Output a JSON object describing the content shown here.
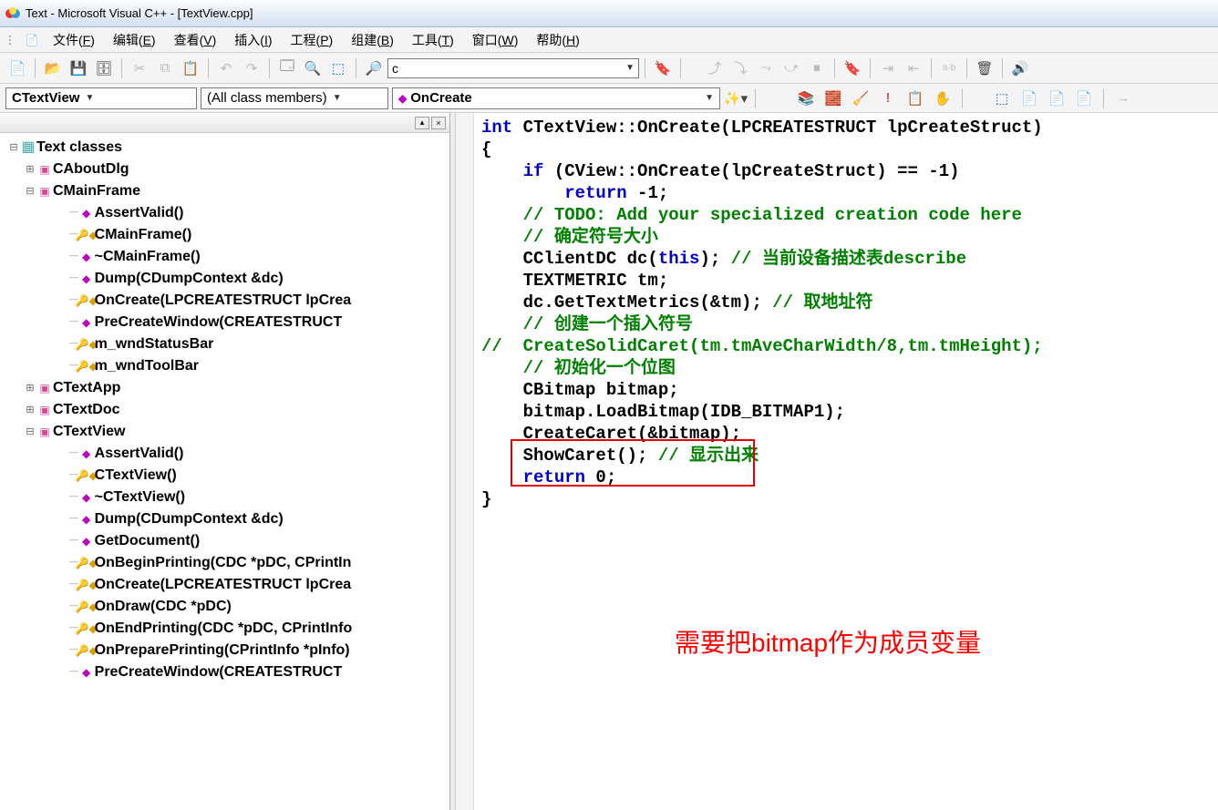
{
  "titlebar": {
    "title": "Text - Microsoft Visual C++ - [TextView.cpp]"
  },
  "menu": {
    "items": [
      {
        "label": "文件(F)",
        "key": "F"
      },
      {
        "label": "编辑(E)",
        "key": "E"
      },
      {
        "label": "查看(V)",
        "key": "V"
      },
      {
        "label": "插入(I)",
        "key": "I"
      },
      {
        "label": "工程(P)",
        "key": "P"
      },
      {
        "label": "组建(B)",
        "key": "B"
      },
      {
        "label": "工具(T)",
        "key": "T"
      },
      {
        "label": "窗口(W)",
        "key": "W"
      },
      {
        "label": "帮助(H)",
        "key": "H"
      }
    ]
  },
  "toolbar": {
    "search_value": "c"
  },
  "wizardbar": {
    "class_combo": "CTextView",
    "filter_combo": "(All class members)",
    "member_combo": "OnCreate"
  },
  "classview": {
    "root": "Text classes",
    "nodes": [
      {
        "type": "class",
        "label": "CAboutDlg",
        "expand": "plus"
      },
      {
        "type": "class",
        "label": "CMainFrame",
        "expand": "minus",
        "children": [
          {
            "icon": "pub",
            "label": "AssertValid()"
          },
          {
            "icon": "prot",
            "label": "CMainFrame()"
          },
          {
            "icon": "pub",
            "label": "~CMainFrame()"
          },
          {
            "icon": "pub",
            "label": "Dump(CDumpContext &dc)"
          },
          {
            "icon": "prot",
            "label": "OnCreate(LPCREATESTRUCT lpCrea"
          },
          {
            "icon": "pub",
            "label": "PreCreateWindow(CREATESTRUCT"
          },
          {
            "icon": "prot",
            "label": "m_wndStatusBar"
          },
          {
            "icon": "prot",
            "label": "m_wndToolBar"
          }
        ]
      },
      {
        "type": "class",
        "label": "CTextApp",
        "expand": "plus"
      },
      {
        "type": "class",
        "label": "CTextDoc",
        "expand": "plus"
      },
      {
        "type": "class",
        "label": "CTextView",
        "expand": "minus",
        "children": [
          {
            "icon": "pub",
            "label": "AssertValid()"
          },
          {
            "icon": "prot",
            "label": "CTextView()"
          },
          {
            "icon": "pub",
            "label": "~CTextView()"
          },
          {
            "icon": "pub",
            "label": "Dump(CDumpContext &dc)"
          },
          {
            "icon": "pub",
            "label": "GetDocument()"
          },
          {
            "icon": "prot",
            "label": "OnBeginPrinting(CDC *pDC, CPrintIn"
          },
          {
            "icon": "prot",
            "label": "OnCreate(LPCREATESTRUCT lpCrea"
          },
          {
            "icon": "prot",
            "label": "OnDraw(CDC *pDC)"
          },
          {
            "icon": "prot",
            "label": "OnEndPrinting(CDC *pDC, CPrintInfo"
          },
          {
            "icon": "prot",
            "label": "OnPreparePrinting(CPrintInfo *pInfo)"
          },
          {
            "icon": "pub",
            "label": "PreCreateWindow(CREATESTRUCT"
          }
        ]
      }
    ]
  },
  "code": {
    "lines": [
      {
        "t": "int",
        "s": [
          [
            "kw",
            "int"
          ],
          [
            "",
            " CTextView::OnCreate(LPCREATESTRUCT lpCreateStruct)"
          ]
        ]
      },
      {
        "t": "{",
        "s": [
          [
            "",
            "{"
          ]
        ]
      },
      {
        "t": "if",
        "s": [
          [
            "",
            "    "
          ],
          [
            "kw",
            "if"
          ],
          [
            "",
            " (CView::OnCreate(lpCreateStruct) == -1)"
          ]
        ]
      },
      {
        "t": "ret",
        "s": [
          [
            "",
            "        "
          ],
          [
            "kw",
            "return"
          ],
          [
            "",
            " -1;"
          ]
        ]
      },
      {
        "t": "",
        "s": [
          [
            "",
            ""
          ]
        ]
      },
      {
        "t": "todo",
        "s": [
          [
            "",
            "    "
          ],
          [
            "cm",
            "// TODO: Add your specialized creation code here"
          ]
        ]
      },
      {
        "t": "",
        "s": [
          [
            "",
            ""
          ]
        ]
      },
      {
        "t": "c1",
        "s": [
          [
            "",
            "    "
          ],
          [
            "cm",
            "// 确定符号大小"
          ]
        ]
      },
      {
        "t": "cc",
        "s": [
          [
            "",
            "    CClientDC dc("
          ],
          [
            "kw",
            "this"
          ],
          [
            "",
            "); "
          ],
          [
            "cm",
            "// 当前设备描述表describe"
          ]
        ]
      },
      {
        "t": "tm",
        "s": [
          [
            "",
            "    TEXTMETRIC tm;"
          ]
        ]
      },
      {
        "t": "gtm",
        "s": [
          [
            "",
            "    dc.GetTextMetrics(&tm); "
          ],
          [
            "cm",
            "// 取地址符"
          ]
        ]
      },
      {
        "t": "",
        "s": [
          [
            "",
            ""
          ]
        ]
      },
      {
        "t": "c2",
        "s": [
          [
            "",
            "    "
          ],
          [
            "cm",
            "// 创建一个插入符号"
          ]
        ]
      },
      {
        "t": "csc",
        "s": [
          [
            "cm",
            "//  CreateSolidCaret(tm.tmAveCharWidth/8,tm.tmHeight);"
          ]
        ]
      },
      {
        "t": "",
        "s": [
          [
            "",
            ""
          ]
        ]
      },
      {
        "t": "c3",
        "s": [
          [
            "",
            "    "
          ],
          [
            "cm",
            "// 初始化一个位图"
          ]
        ]
      },
      {
        "t": "cb",
        "s": [
          [
            "",
            "    CBitmap bitmap;"
          ]
        ]
      },
      {
        "t": "lb",
        "s": [
          [
            "",
            "    bitmap.LoadBitmap(IDB_BITMAP1);"
          ]
        ]
      },
      {
        "t": "ccr",
        "s": [
          [
            "",
            "    CreateCaret(&bitmap);"
          ]
        ]
      },
      {
        "t": "",
        "s": [
          [
            "",
            ""
          ]
        ]
      },
      {
        "t": "sc",
        "s": [
          [
            "",
            "    ShowCaret(); "
          ],
          [
            "cm",
            "// 显示出来"
          ]
        ]
      },
      {
        "t": "",
        "s": [
          [
            "",
            ""
          ]
        ]
      },
      {
        "t": "r0",
        "s": [
          [
            "",
            "    "
          ],
          [
            "kw",
            "return"
          ],
          [
            "",
            " 0;"
          ]
        ]
      },
      {
        "t": "}",
        "s": [
          [
            "",
            "}"
          ]
        ]
      }
    ]
  },
  "annotation": {
    "text": "需要把bitmap作为成员变量"
  }
}
